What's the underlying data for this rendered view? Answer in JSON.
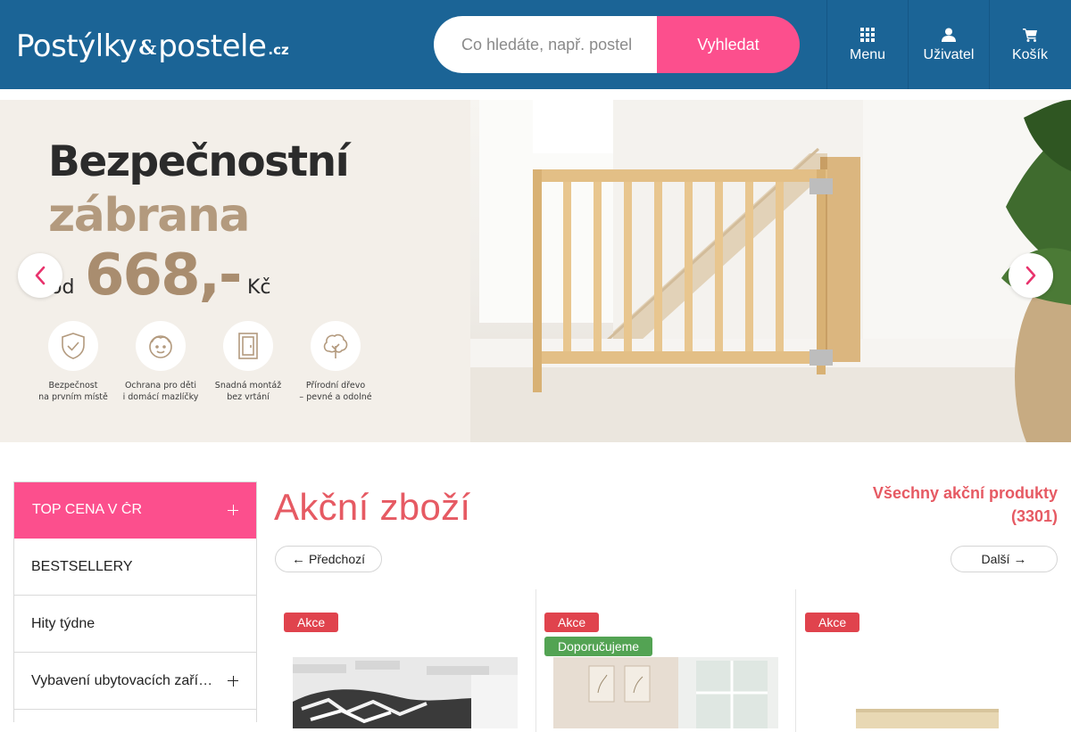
{
  "header": {
    "logo": {
      "part1": "Postýlky",
      "amp": "&",
      "part2": "postele",
      "tld": ".cz"
    },
    "search": {
      "placeholder": "Co hledáte, např. postel",
      "button_label": "Vyhledat"
    },
    "nav": [
      {
        "label": "Menu",
        "icon": "grid-icon"
      },
      {
        "label": "Uživatel",
        "icon": "user-icon"
      },
      {
        "label": "Košík",
        "icon": "cart-icon"
      }
    ]
  },
  "banner": {
    "title_line1": "Bezpečnostní",
    "title_line2": "zábrana",
    "price_prefix": "od",
    "price": "668,-",
    "currency": "Kč",
    "features": [
      {
        "label": "Bezpečnost\nna prvním místě",
        "icon": "shield-check-icon"
      },
      {
        "label": "Ochrana pro děti\ni domácí mazlíčky",
        "icon": "child-face-icon"
      },
      {
        "label": "Snadná montáž\nbez vrtání",
        "icon": "door-icon"
      },
      {
        "label": "Přírodní dřevo\n– pevné a odolné",
        "icon": "tree-icon"
      }
    ],
    "prev_icon": "chevron-left-icon",
    "next_icon": "chevron-right-icon"
  },
  "sidebar": {
    "items": [
      {
        "label": "TOP CENA V ČR",
        "active": true,
        "expandable": true
      },
      {
        "label": "BESTSELLERY",
        "active": false,
        "expandable": false
      },
      {
        "label": "Hity týdne",
        "active": false,
        "expandable": false
      },
      {
        "label": "Vybavení ubytovacích zařízení",
        "active": false,
        "expandable": true
      }
    ]
  },
  "main": {
    "title": "Akční zboží",
    "all_link": "Všechny akční produkty (3301)",
    "prev_label": "Předchozí",
    "next_label": "Další",
    "products": [
      {
        "badges": [
          "Akce"
        ]
      },
      {
        "badges": [
          "Akce",
          "Doporučujeme"
        ]
      },
      {
        "badges": [
          "Akce"
        ]
      }
    ]
  },
  "colors": {
    "header_bg": "#1b6496",
    "accent_pink": "#fc4f8d",
    "title_red": "#e65a63",
    "badge_sale": "#e0434d",
    "badge_recommended": "#53a353",
    "banner_gold": "#b39a7e"
  }
}
